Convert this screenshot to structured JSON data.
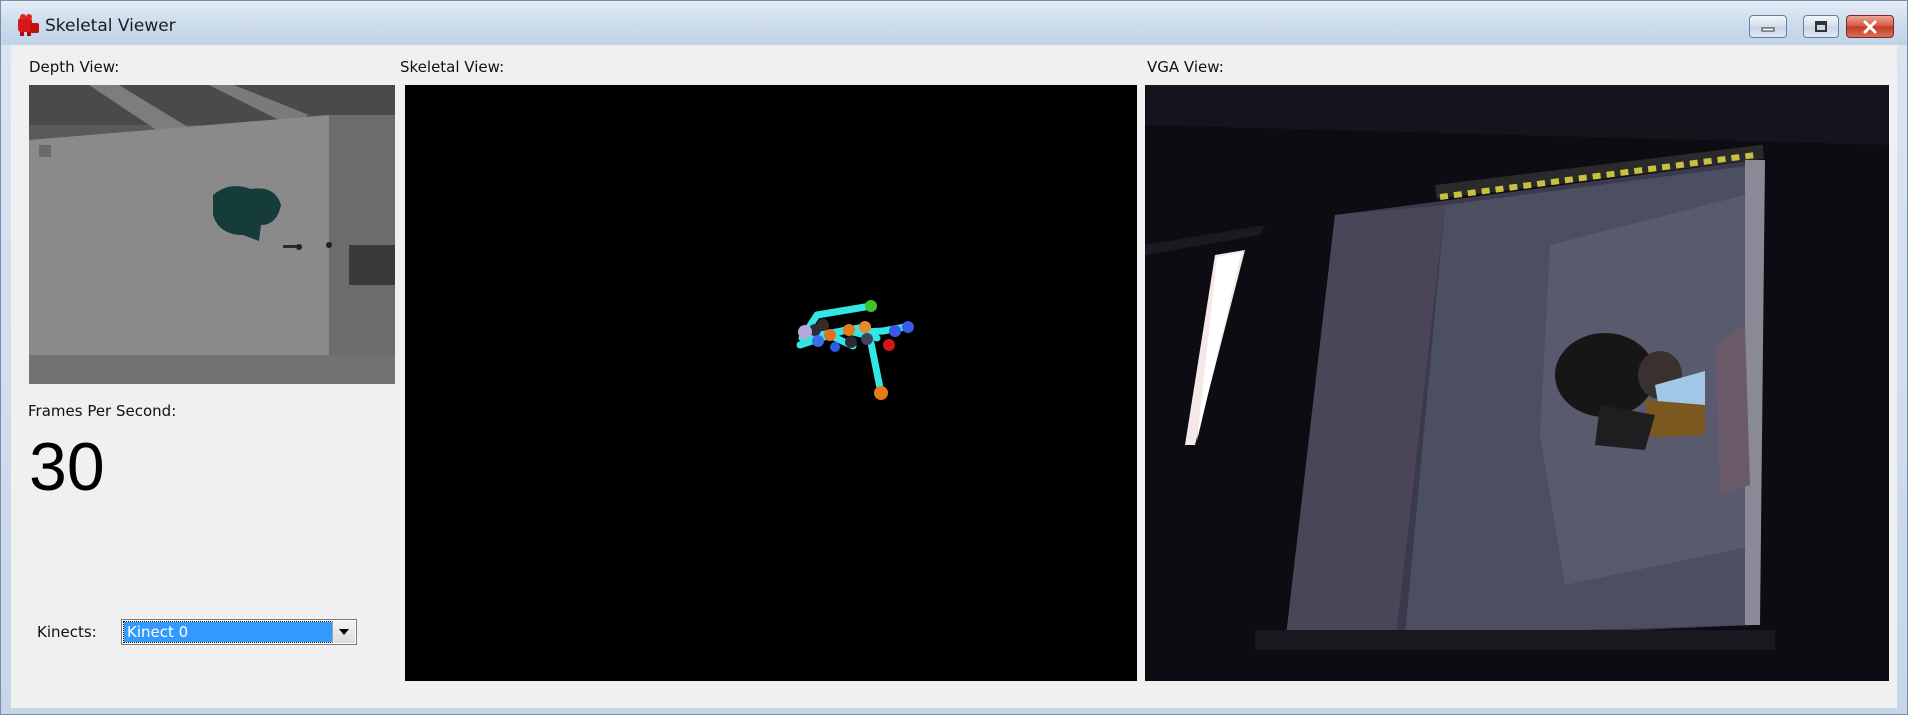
{
  "window": {
    "title": "Skeletal Viewer",
    "controls": [
      "minimize",
      "maximize",
      "close"
    ]
  },
  "depth_view": {
    "label": "Depth View:"
  },
  "skeletal_view": {
    "label": "Skeletal View:"
  },
  "vga_view": {
    "label": "VGA View:"
  },
  "fps": {
    "label": "Frames Per Second:",
    "value": "30"
  },
  "kinects": {
    "label": "Kinects:",
    "selected": "Kinect 0"
  },
  "colors": {
    "accent_selection": "#3399ff",
    "bone_color": "#33e6e6",
    "panel_background": "#000000"
  },
  "icons": {
    "app": "kinect-red-icon",
    "minimize": "minimize-icon",
    "maximize": "maximize-icon",
    "close": "close-icon",
    "dropdown": "chevron-down-icon"
  }
}
